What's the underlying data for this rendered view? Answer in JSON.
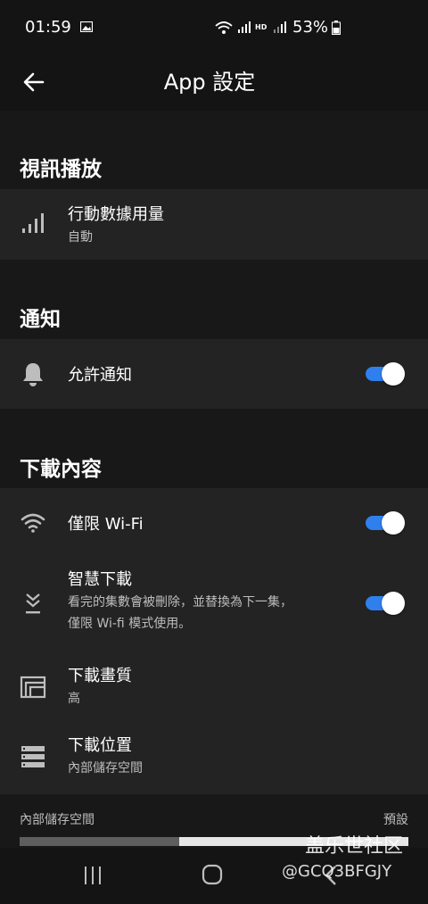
{
  "status_bar": {
    "time": "01:59",
    "battery": "53%",
    "icons": [
      "image-icon",
      "wifi-calling-icon",
      "signal-icon",
      "hd-icon",
      "signal-icon",
      "battery-icon"
    ]
  },
  "app_bar": {
    "title": "App 設定",
    "back_icon": "arrow-left-icon"
  },
  "sections": {
    "video": {
      "header": "視訊播放",
      "items": [
        {
          "title": "行動數據用量",
          "subtitle": "自動",
          "icon": "cellular-data-icon"
        }
      ]
    },
    "notifications": {
      "header": "通知",
      "items": [
        {
          "title": "允許通知",
          "icon": "bell-icon",
          "toggle": true
        }
      ]
    },
    "downloads": {
      "header": "下載內容",
      "items": [
        {
          "title": "僅限 Wi-Fi",
          "icon": "wifi-icon",
          "toggle": true
        },
        {
          "title": "智慧下載",
          "subtitle_line1": "看完的集數會被刪除，並替換為下一集，",
          "subtitle_line2": "僅限 Wi-fi 模式使用。",
          "icon": "smart-download-icon",
          "toggle": true
        },
        {
          "title": "下載畫質",
          "subtitle": "高",
          "icon": "video-quality-icon"
        },
        {
          "title": "下載位置",
          "subtitle": "內部儲存空間",
          "icon": "storage-icon"
        }
      ]
    }
  },
  "storage": {
    "label": "內部儲存空間",
    "default_label": "預設",
    "used_fraction": 0.41
  },
  "nav_bar": {
    "icons": [
      "recent-apps-icon",
      "home-icon",
      "back-icon"
    ]
  },
  "watermark": {
    "line1": "盖乐世社区",
    "line2": "@GCQ3BFGJY"
  },
  "colors": {
    "accent": "#2f80ed",
    "background": "#141414",
    "card": "#232323"
  }
}
